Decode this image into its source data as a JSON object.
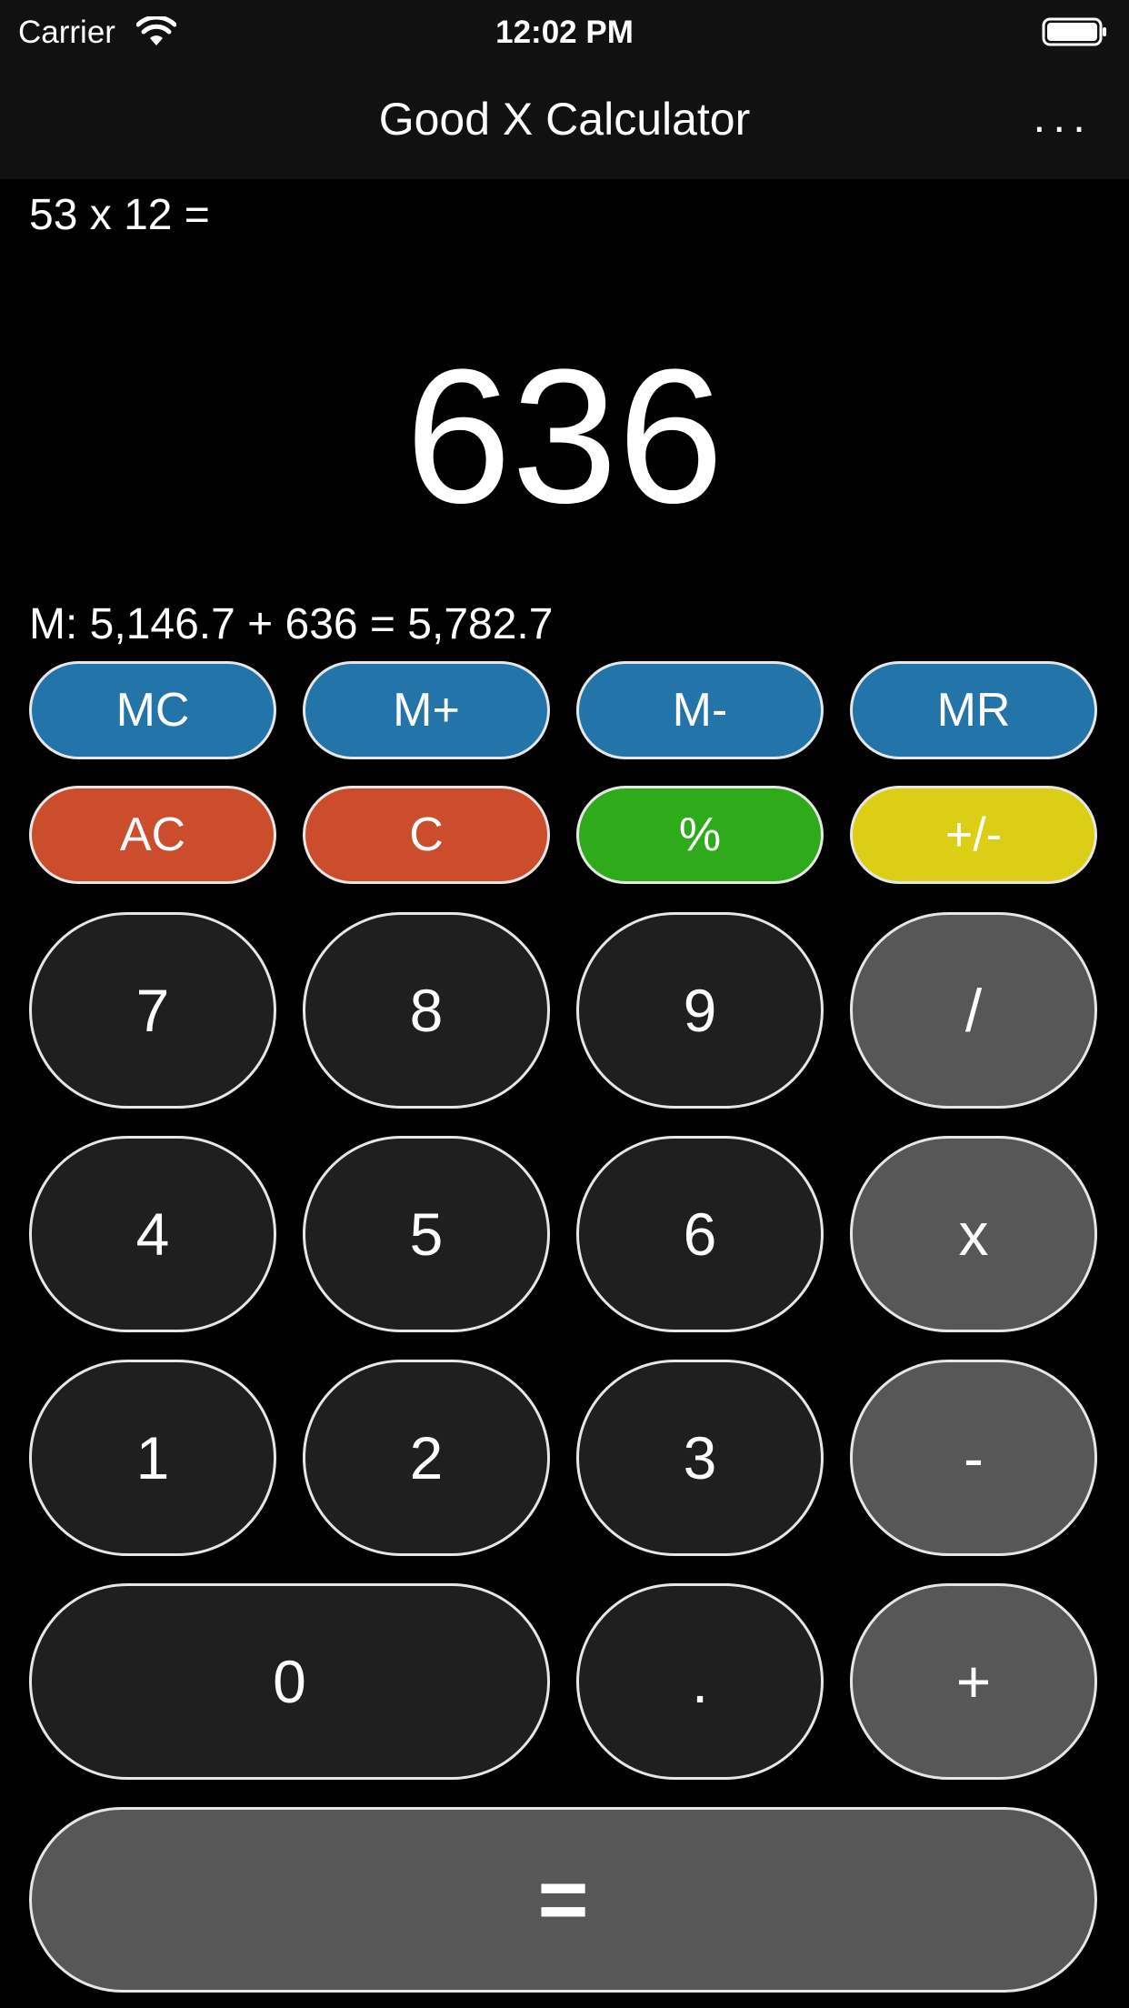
{
  "status_bar": {
    "carrier": "Carrier",
    "time": "12:02 PM",
    "wifi_icon": "wifi-icon",
    "battery_icon": "battery-icon"
  },
  "nav": {
    "title": "Good X Calculator",
    "more_label": "..."
  },
  "display": {
    "expression": "53 x 12 =",
    "result": "636",
    "memory": "M: 5,146.7 + 636 = 5,782.7"
  },
  "buttons": {
    "mc": "MC",
    "m_plus": "M+",
    "m_minus": "M-",
    "mr": "MR",
    "ac": "AC",
    "c": "C",
    "percent": "%",
    "plus_minus": "+/-",
    "seven": "7",
    "eight": "8",
    "nine": "9",
    "divide": "/",
    "four": "4",
    "five": "5",
    "six": "6",
    "multiply": "x",
    "one": "1",
    "two": "2",
    "three": "3",
    "minus": "-",
    "zero": "0",
    "decimal": ".",
    "plus": "+",
    "equals": "="
  },
  "colors": {
    "memory_buttons": "#2374a9",
    "clear_buttons": "#cb4d2c",
    "percent_button": "#2faa1b",
    "sign_button": "#dccd15",
    "digit_buttons": "#1f1f1f",
    "operator_buttons": "#575757",
    "background": "#000000"
  }
}
